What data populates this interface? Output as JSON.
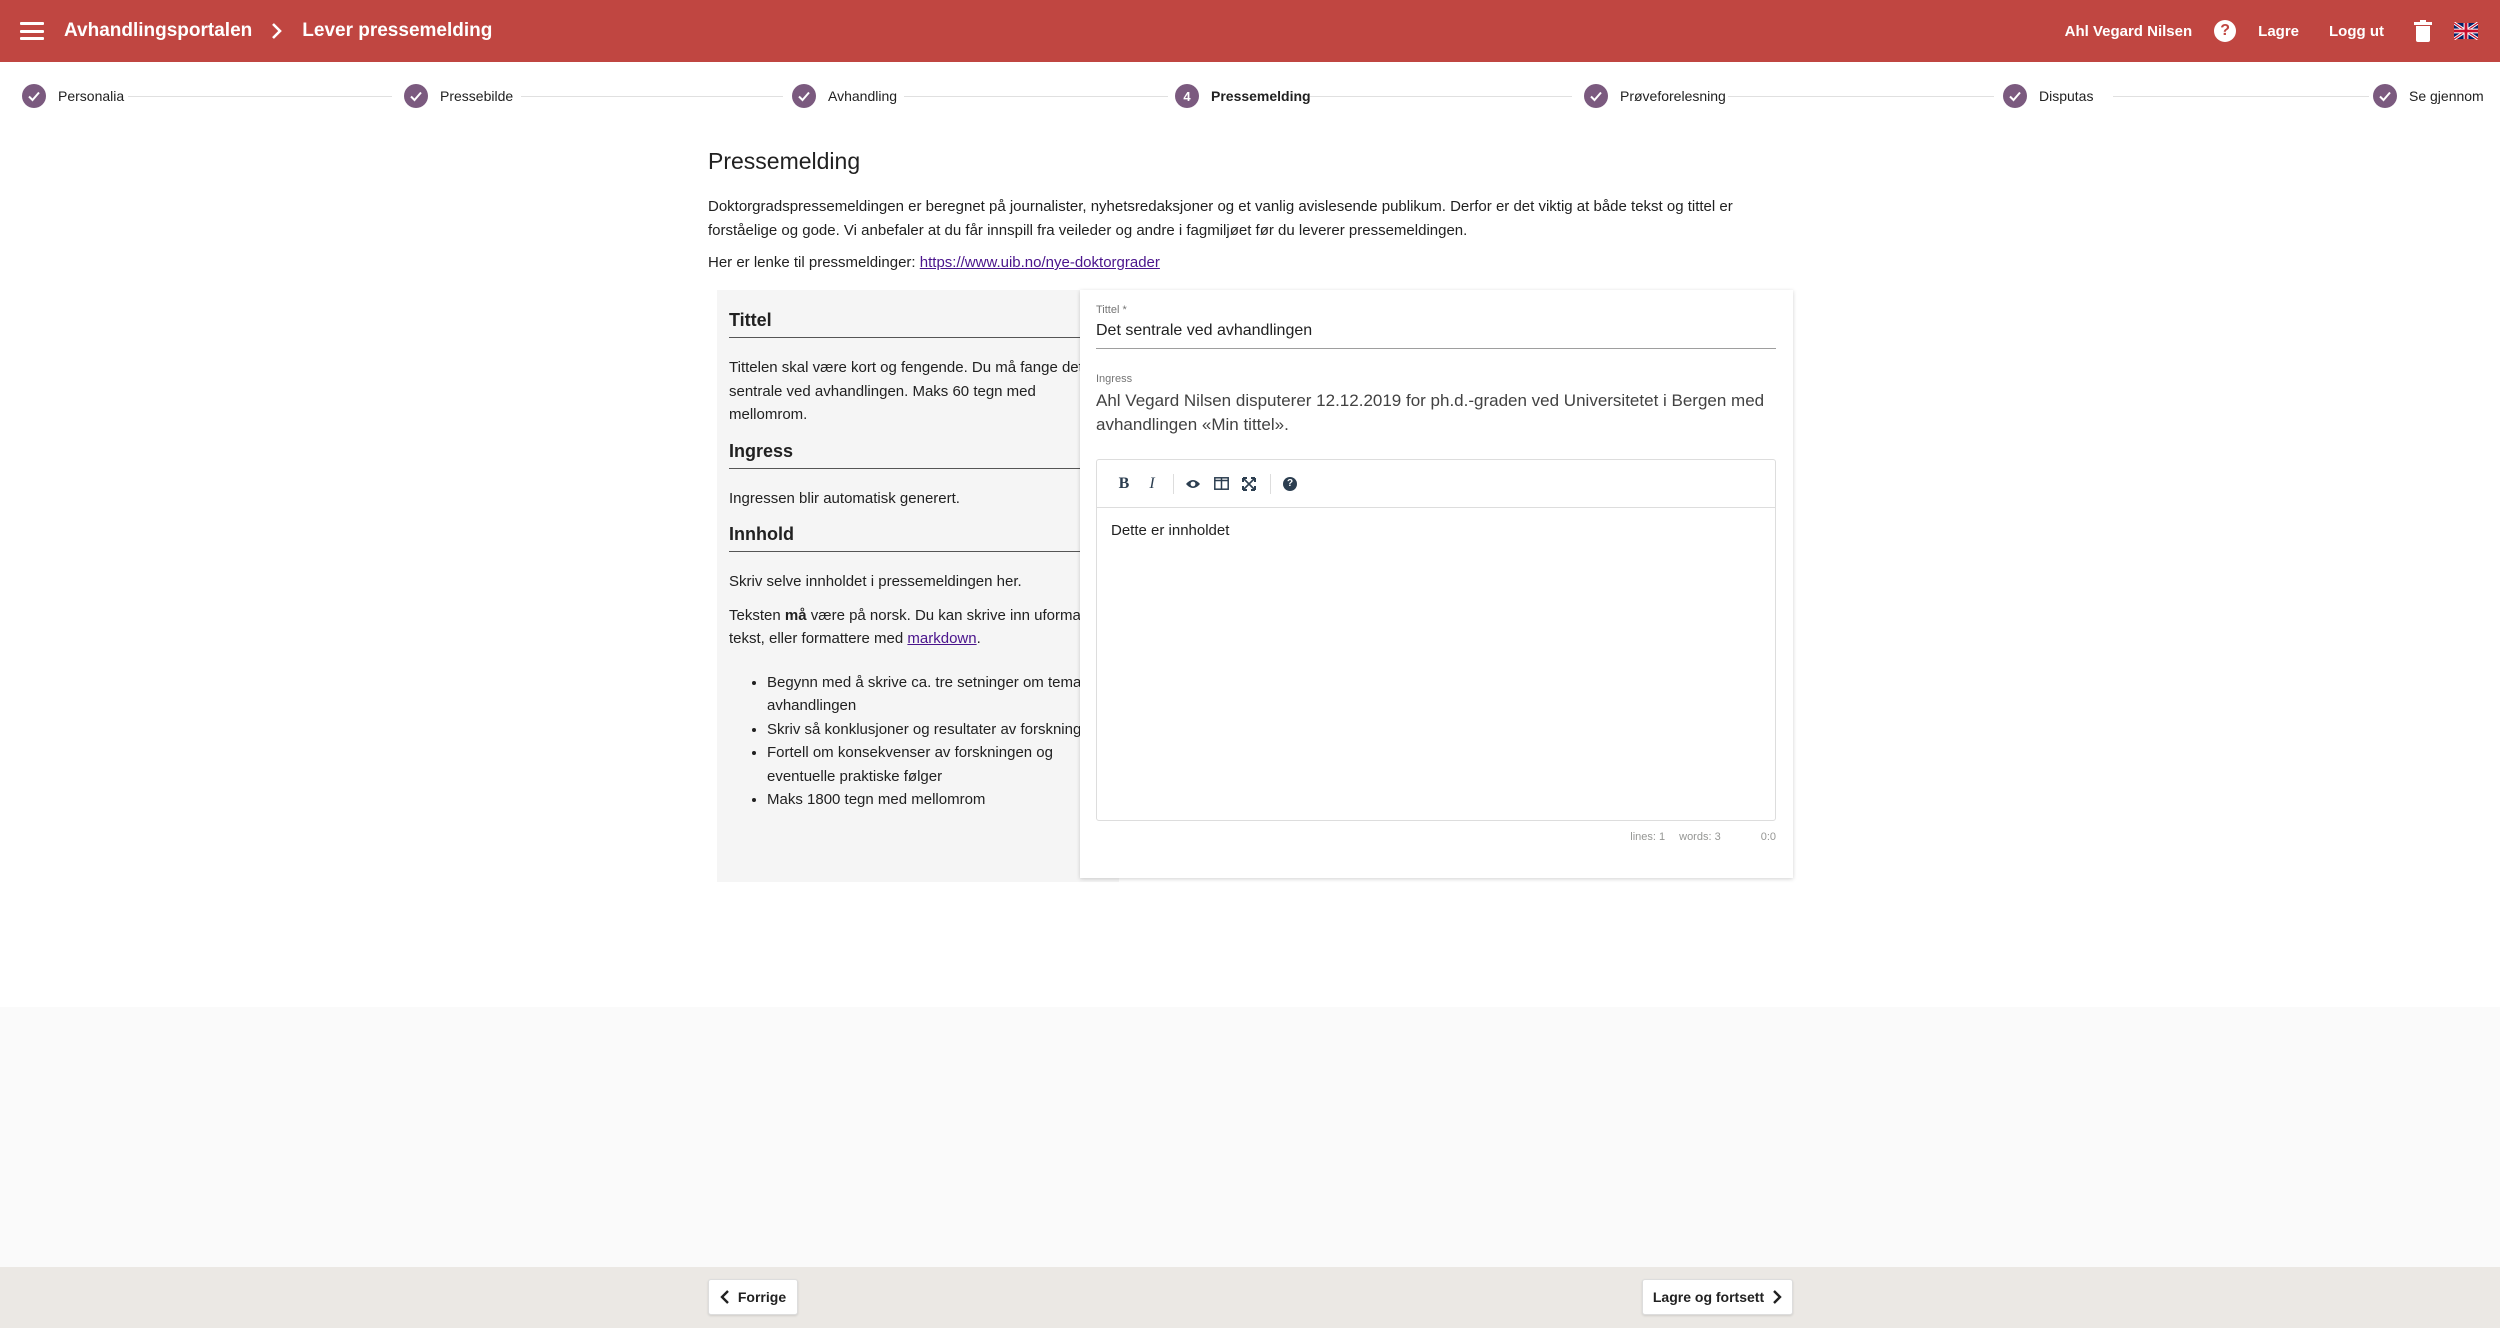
{
  "appbar": {
    "app_name": "Avhandlingsportalen",
    "page_name": "Lever pressemelding",
    "user_name": "Ahl Vegard Nilsen",
    "save_label": "Lagre",
    "logout_label": "Logg ut",
    "help_glyph": "?",
    "color": "#c04641"
  },
  "stepper": {
    "steps": [
      {
        "label": "Personalia",
        "state": "done"
      },
      {
        "label": "Pressebilde",
        "state": "done"
      },
      {
        "label": "Avhandling",
        "state": "done"
      },
      {
        "label": "Pressemelding",
        "state": "active",
        "number": "4"
      },
      {
        "label": "Prøveforelesning",
        "state": "done"
      },
      {
        "label": "Disputas",
        "state": "done"
      },
      {
        "label": "Se gjennom",
        "state": "done"
      }
    ],
    "color": "#7b5a7f"
  },
  "main": {
    "title": "Pressemelding",
    "intro": "Doktorgradspressemeldingen er beregnet på journalister, nyhetsredaksjoner og et vanlig avislesende publikum. Derfor er det viktig at både tekst og tittel er forståelige og gode. Vi anbefaler at du får innspill fra veileder og andre i fagmiljøet før du leverer pressemeldingen.",
    "link_prefix": "Her er lenke til pressmeldinger:",
    "link_text": "https://www.uib.no/nye-doktorgrader"
  },
  "help": {
    "title_heading": "Tittel",
    "title_text": "Tittelen skal være kort og fengende. Du må fange det sentrale ved avhandlingen. Maks 60 tegn med mellomrom.",
    "ingress_heading": "Ingress",
    "ingress_text": "Ingressen blir automatisk generert.",
    "content_heading": "Innhold",
    "content_text": "Skriv selve innholdet i pressemeldingen her.",
    "lang_pre": "Teksten ",
    "lang_bold": "må",
    "lang_post": " være på norsk. Du kan skrive inn uformattert tekst, eller formattere med ",
    "markdown_link": "markdown",
    "lang_end": ".",
    "bullets": [
      "Begynn med å skrive ca. tre setninger om tema for avhandlingen",
      "Skriv så konklusjoner og resultater av forskningen",
      "Fortell om konsekvenser av forskningen og eventuelle praktiske følger",
      "Maks 1800 tegn med mellomrom"
    ]
  },
  "form": {
    "title_label": "Tittel *",
    "title_value": "Det sentrale ved avhandlingen",
    "ingress_label": "Ingress",
    "ingress_value": "Ahl Vegard Nilsen disputerer 12.12.2019 for ph.d.-graden ved Universitetet i Bergen med avhandlingen «Min tittel».",
    "editor_content": "Dette er innholdet",
    "toolbar": {
      "bold": "B",
      "italic": "I",
      "help": "?"
    },
    "status": {
      "lines": "lines: 1",
      "words": "words: 3",
      "cursor": "0:0"
    }
  },
  "footer": {
    "prev_label": "Forrige",
    "next_label": "Lagre og fortsett"
  }
}
